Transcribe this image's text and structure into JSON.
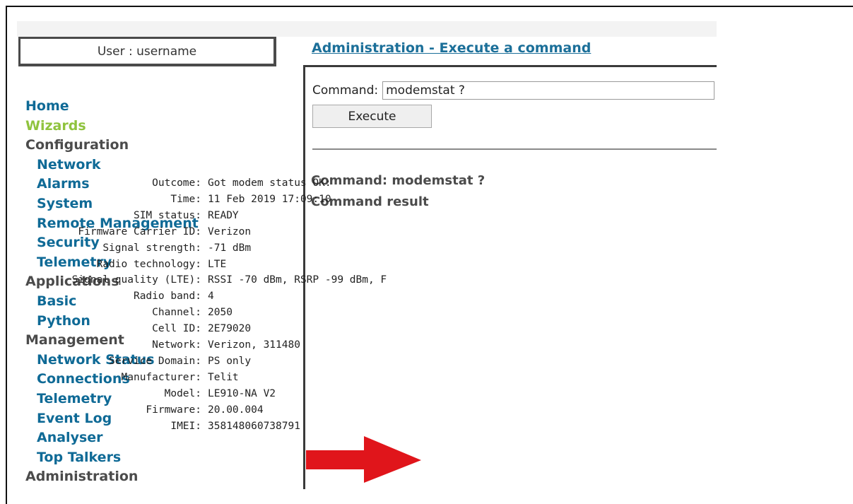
{
  "user_box": {
    "text": "User : username"
  },
  "nav": {
    "items": [
      {
        "label": "Home",
        "kind": "link",
        "sub": false
      },
      {
        "label": "Wizards",
        "kind": "active",
        "sub": false
      },
      {
        "label": "Configuration",
        "kind": "section",
        "sub": false
      },
      {
        "label": "Network",
        "kind": "link",
        "sub": true
      },
      {
        "label": "Alarms",
        "kind": "link",
        "sub": true
      },
      {
        "label": "System",
        "kind": "link",
        "sub": true
      },
      {
        "label": "Remote Management",
        "kind": "link",
        "sub": true
      },
      {
        "label": "Security",
        "kind": "link",
        "sub": true
      },
      {
        "label": "Telemetry",
        "kind": "link",
        "sub": true
      },
      {
        "label": "Applications",
        "kind": "section",
        "sub": false
      },
      {
        "label": "Basic",
        "kind": "link",
        "sub": true
      },
      {
        "label": "Python",
        "kind": "link",
        "sub": true
      },
      {
        "label": "Management",
        "kind": "section",
        "sub": false
      },
      {
        "label": "Network Status",
        "kind": "link",
        "sub": true
      },
      {
        "label": "Connections",
        "kind": "link",
        "sub": true
      },
      {
        "label": "Telemetry",
        "kind": "link",
        "sub": true
      },
      {
        "label": "Event Log",
        "kind": "link",
        "sub": true
      },
      {
        "label": "Analyser",
        "kind": "link",
        "sub": true
      },
      {
        "label": "Top Talkers",
        "kind": "link",
        "sub": true
      },
      {
        "label": "Administration",
        "kind": "section",
        "sub": false
      }
    ]
  },
  "main": {
    "title": "Administration - Execute a command",
    "command_label": "Command:",
    "command_value": "modemstat ?",
    "execute_label": "Execute",
    "result_command": "Command: modemstat ?",
    "result_title": "Command result",
    "output": [
      {
        "key": "Outcome:",
        "value": "Got modem status OK:"
      },
      {
        "key": "Time:",
        "value": "11 Feb 2019 17:09:10"
      },
      {
        "key": "SIM status:",
        "value": "READY"
      },
      {
        "key": "Firmware Carrier ID:",
        "value": "Verizon"
      },
      {
        "key": "Signal strength:",
        "value": "-71 dBm"
      },
      {
        "key": "Radio technology:",
        "value": "LTE"
      },
      {
        "key": "Signal quality (LTE):",
        "value": "RSSI -70 dBm, RSRP -99 dBm, F"
      },
      {
        "key": "Radio band:",
        "value": "4"
      },
      {
        "key": "Channel:",
        "value": "2050"
      },
      {
        "key": "Cell ID:",
        "value": "2E79020"
      },
      {
        "key": "Network:",
        "value": "Verizon, 311480"
      },
      {
        "key": "Service Domain:",
        "value": "PS only"
      },
      {
        "key": "Manufacturer:",
        "value": "Telit"
      },
      {
        "key": "Model:",
        "value": "LE910-NA V2"
      },
      {
        "key": "Firmware:",
        "value": "20.00.004"
      },
      {
        "key": "IMEI:",
        "value": "358148060738791"
      }
    ]
  },
  "colors": {
    "link": "#0f6a96",
    "section": "#4b4b4b",
    "active": "#8fc33e",
    "arrow": "#e0151b"
  }
}
